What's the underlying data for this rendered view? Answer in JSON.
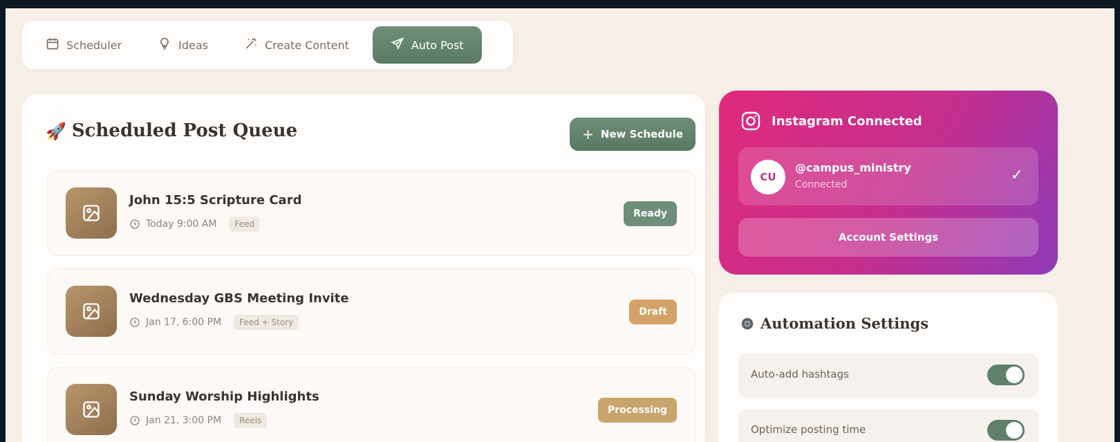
{
  "nav": {
    "items": [
      {
        "label": "Scheduler",
        "icon": "calendar-icon"
      },
      {
        "label": "Ideas",
        "icon": "lightbulb-icon"
      },
      {
        "label": "Create Content",
        "icon": "magic-wand-icon"
      },
      {
        "label": "Auto Post",
        "icon": "send-icon",
        "active": true
      }
    ]
  },
  "queue": {
    "title": "Scheduled Post Queue",
    "title_emoji": "🚀",
    "new_button": "New Schedule",
    "new_button_icon": "+",
    "posts": [
      {
        "title": "John 15:5 Scripture Card",
        "time": "Today 9:00 AM",
        "tag": "Feed",
        "status": "Ready",
        "status_color": "#6f8e79"
      },
      {
        "title": "Wednesday GBS Meeting Invite",
        "time": "Jan 17, 6:00 PM",
        "tag": "Feed + Story",
        "status": "Draft",
        "status_color": "#d4a266"
      },
      {
        "title": "Sunday Worship Highlights",
        "time": "Jan 21, 3:00 PM",
        "tag": "Reels",
        "status": "Processing",
        "status_color": "#c9a46c"
      }
    ]
  },
  "instagram": {
    "title": "Instagram Connected",
    "avatar_initials": "CU",
    "handle": "@campus_ministry",
    "connection_status": "Connected",
    "check": "✓",
    "settings_button": "Account Settings"
  },
  "automation": {
    "title": "Automation Settings",
    "settings": [
      {
        "label": "Auto-add hashtags",
        "enabled": true
      },
      {
        "label": "Optimize posting time",
        "enabled": true
      }
    ]
  }
}
